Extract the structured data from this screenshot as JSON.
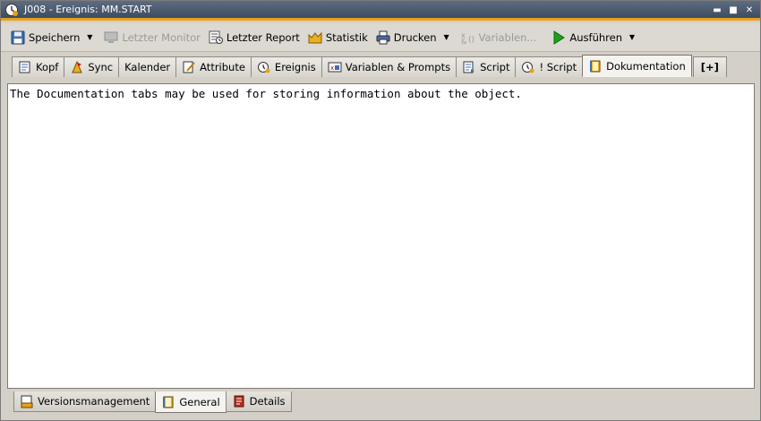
{
  "window": {
    "title": "J008 - Ereignis: MM.START"
  },
  "toolbar": {
    "save_label": "Speichern",
    "last_monitor_label": "Letzter Monitor",
    "last_report_label": "Letzter Report",
    "statistics_label": "Statistik",
    "print_label": "Drucken",
    "variables_label": "Variablen...",
    "execute_label": "Ausführen"
  },
  "tabs": [
    {
      "label": "Kopf",
      "icon": "header-icon"
    },
    {
      "label": "Sync",
      "icon": "sync-icon"
    },
    {
      "label": "Kalender",
      "icon": ""
    },
    {
      "label": "Attribute",
      "icon": "attribute-icon"
    },
    {
      "label": "Ereignis",
      "icon": "event-icon"
    },
    {
      "label": "Variablen & Prompts",
      "icon": "variables-icon"
    },
    {
      "label": "Script",
      "icon": "script-icon"
    },
    {
      "label": "! Script",
      "icon": "event-script-icon"
    },
    {
      "label": "Dokumentation",
      "icon": "documentation-icon",
      "active": true
    },
    {
      "label": "[+]",
      "icon": "add-tab-icon"
    }
  ],
  "content": {
    "text": "The Documentation tabs may be used for storing information about the object."
  },
  "bottom_tabs": [
    {
      "label": "Versionsmanagement",
      "icon": "version-icon"
    },
    {
      "label": "General",
      "icon": "general-icon",
      "active": true
    },
    {
      "label": "Details",
      "icon": "details-icon"
    }
  ],
  "colors": {
    "titlebar": "#4a586d",
    "accent_stripe": "#e8a018",
    "execute_green": "#1ea01e"
  }
}
